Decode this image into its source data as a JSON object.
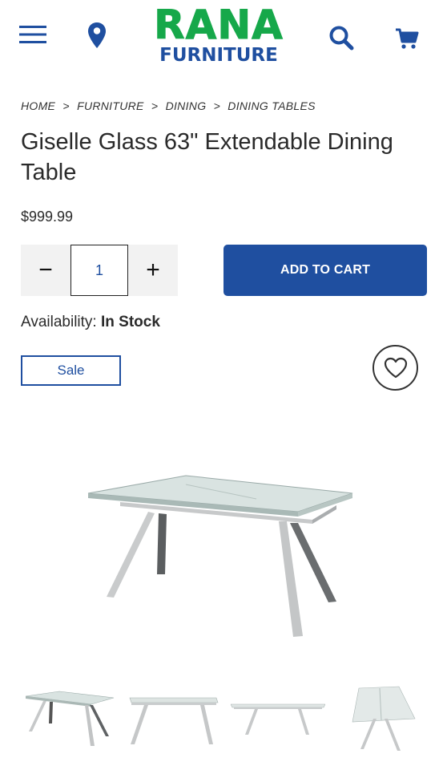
{
  "header": {
    "logo_line1": "RANA",
    "logo_line2": "FURNITURE",
    "icons": [
      "menu-icon",
      "location-pin-icon",
      "search-icon",
      "cart-icon"
    ],
    "brand_green": "#16a84a",
    "brand_blue": "#1f4fa0"
  },
  "breadcrumb": [
    "HOME",
    "FURNITURE",
    "DINING",
    "DINING TABLES"
  ],
  "breadcrumb_separator": ">",
  "product": {
    "title": "Giselle Glass 63\" Extendable Dining Table",
    "price": "$999.99",
    "quantity": "1",
    "minus_label": "−",
    "plus_label": "+",
    "add_to_cart": "ADD TO CART",
    "availability_label": "Availability:",
    "availability_value": "In Stock",
    "badge": "Sale"
  },
  "gallery": {
    "thumbnails": 4
  }
}
